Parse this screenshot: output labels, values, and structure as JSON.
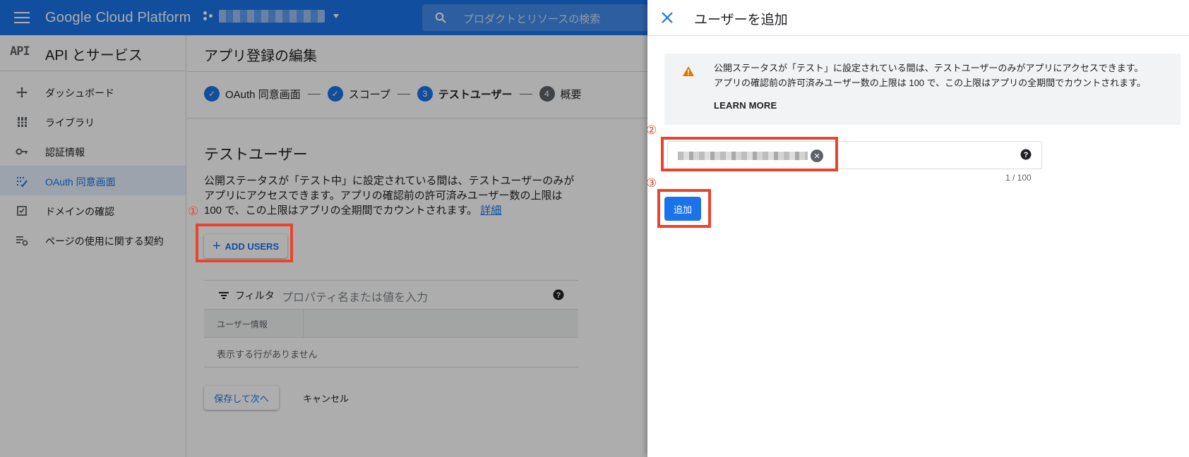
{
  "topbar": {
    "brand": "Google Cloud Platform",
    "search_placeholder": "プロダクトとリソースの検索"
  },
  "sidebar": {
    "logo": "API",
    "title": "API とサービス",
    "items": [
      {
        "label": "ダッシュボード",
        "icon": "dashboard-icon"
      },
      {
        "label": "ライブラリ",
        "icon": "library-icon"
      },
      {
        "label": "認証情報",
        "icon": "key-icon"
      },
      {
        "label": "OAuth 同意画面",
        "icon": "oauth-consent-icon",
        "active": true
      },
      {
        "label": "ドメインの確認",
        "icon": "domain-verify-icon"
      },
      {
        "label": "ページの使用に関する契約",
        "icon": "page-settings-icon"
      }
    ]
  },
  "main": {
    "title": "アプリ登録の編集",
    "steps": [
      {
        "number": "✓",
        "label": "OAuth 同意画面",
        "state": "done"
      },
      {
        "number": "✓",
        "label": "スコープ",
        "state": "done"
      },
      {
        "number": "3",
        "label": "テストユーザー",
        "state": "current"
      },
      {
        "number": "4",
        "label": "概要",
        "state": "todo"
      }
    ],
    "section_title": "テストユーザー",
    "description": "公開ステータスが「テスト中」に設定されている間は、テストユーザーのみがアプリにアクセスできます。アプリの確認前の許可済みユーザー数の上限は 100 で、この上限はアプリの全期間でカウントされます。",
    "details_link": "詳細",
    "add_users_label": "ADD USERS",
    "filter_label": "フィルタ",
    "filter_placeholder": "プロパティ名または値を入力",
    "table_header": "ユーザー情報",
    "empty_message": "表示する行がありません",
    "save_label": "保存して次へ",
    "cancel_label": "キャンセル"
  },
  "annotations": {
    "one": "①",
    "two": "②",
    "three": "③"
  },
  "drawer": {
    "title": "ユーザーを追加",
    "notice_line1": "公開ステータスが「テスト」に設定されている間は、テストユーザーのみがアプリにアクセスできます。",
    "notice_line2": "アプリの確認前の許可済みユーザー数の上限は 100 で、この上限はアプリの全期間でカウントされます。",
    "learn_more": "LEARN MORE",
    "counter": "1 / 100",
    "add_label": "追加"
  },
  "colors": {
    "accent": "#1a73e8",
    "annotation_red": "#e8452c",
    "warning": "#e37400"
  }
}
